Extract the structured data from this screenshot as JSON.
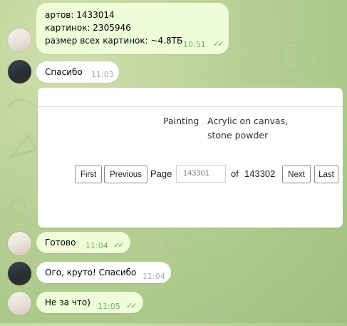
{
  "messages": {
    "stats": {
      "lines": [
        "артов: 1433014",
        "картинок: 2305946",
        "размер всех картинок: ~4.8ТБ"
      ],
      "time": "10:51",
      "status": "read"
    },
    "thanks": {
      "text": "Спасибо",
      "time": "11:03"
    },
    "gotovo": {
      "text": "Готово",
      "time": "11:04",
      "status": "read"
    },
    "reply": {
      "text": "Ого, круто! Спасибо",
      "time": "11:04"
    },
    "welcome": {
      "text": "Не за что)",
      "time": "11:05",
      "status": "read"
    }
  },
  "screenshot": {
    "type_label": "Painting",
    "medium_line1": "Acrylic on canvas,",
    "medium_line2": "stone powder",
    "pagination": {
      "first": "First",
      "previous": "Previous",
      "page_label": "Page",
      "current_page": "143301",
      "of_label": "of",
      "total_pages": "143302",
      "next": "Next",
      "last": "Last"
    }
  },
  "colors": {
    "outgoing_bubble": "#eefed9",
    "incoming_bubble": "#ffffff",
    "check_color": "#54b34a"
  },
  "icons": {
    "read_status": "double-check-icon"
  }
}
